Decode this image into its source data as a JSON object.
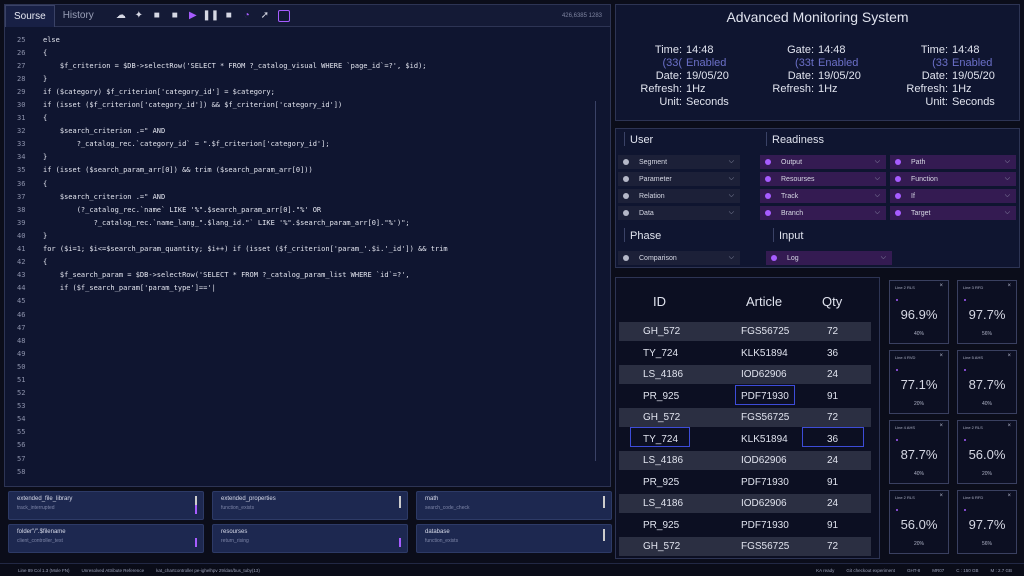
{
  "editor": {
    "tabs": [
      "Sourse",
      "History"
    ],
    "toolbar_icons": [
      "cloud-icon",
      "puzzle-icon",
      "stop-icon",
      "stop-icon",
      "play-icon",
      "pause-icon",
      "stop-icon",
      "clock-icon",
      "cursor-icon",
      "record-icon"
    ],
    "coords": "426,6385 1283",
    "lines": [
      {
        "n": "25",
        "code": "else"
      },
      {
        "n": "26",
        "code": "{"
      },
      {
        "n": "27",
        "code": "    $f_criterion = $DB->selectRow('SELECT * FROM ?_catalog_visual WHERE `page_id`=?', $id);"
      },
      {
        "n": "28",
        "code": "}"
      },
      {
        "n": "29",
        "code": "if ($category) $f_criterion['category_id'] = $category;"
      },
      {
        "n": "30",
        "code": "if (isset ($f_criterion['category_id']) && $f_criterion['category_id'])"
      },
      {
        "n": "31",
        "code": "{"
      },
      {
        "n": "32",
        "code": "    $search_criterion .=\" AND"
      },
      {
        "n": "33",
        "code": "        ?_catalog_rec.`category_id` = \".$f_criterion['category_id'];"
      },
      {
        "n": "34",
        "code": "}"
      },
      {
        "n": "35",
        "code": "if (isset ($search_param_arr[0]) && trim ($search_param_arr[0]))"
      },
      {
        "n": "36",
        "code": "{"
      },
      {
        "n": "37",
        "code": "    $search_criterion .=\" AND"
      },
      {
        "n": "38",
        "code": "        (?_catalog_rec.`name` LIKE '%\".$search_param_arr[0].\"%' OR"
      },
      {
        "n": "39",
        "code": "            ?_catalog_rec.`name_lang_\".$lang_id.\"` LIKE '%\".$search_param_arr[0].\"%')\";"
      },
      {
        "n": "40",
        "code": "}"
      },
      {
        "n": "41",
        "code": "for ($i=1; $i<=$search_param_quantity; $i++) if (isset ($f_criterion['param_'.$i.'_id']) && trim"
      },
      {
        "n": "42",
        "code": "{"
      },
      {
        "n": "43",
        "code": "    $f_search_param = $DB->selectRow('SELECT * FROM ?_catalog_param_list WHERE `id`=?',"
      },
      {
        "n": "44",
        "code": "    if ($f_search_param['param_type']=='|"
      },
      {
        "n": "45",
        "code": ""
      },
      {
        "n": "46",
        "code": ""
      },
      {
        "n": "47",
        "code": ""
      },
      {
        "n": "48",
        "code": ""
      },
      {
        "n": "49",
        "code": ""
      },
      {
        "n": "50",
        "code": ""
      },
      {
        "n": "51",
        "code": ""
      },
      {
        "n": "52",
        "code": ""
      },
      {
        "n": "53",
        "code": ""
      },
      {
        "n": "54",
        "code": ""
      },
      {
        "n": "55",
        "code": ""
      },
      {
        "n": "56",
        "code": ""
      },
      {
        "n": "57",
        "code": ""
      },
      {
        "n": "58",
        "code": ""
      }
    ]
  },
  "cards": [
    {
      "title": "extended_file_library",
      "sub": "track_interrupted"
    },
    {
      "title": "extended_properties",
      "sub": "function_exists"
    },
    {
      "title": "math",
      "sub": "search_code_check"
    },
    {
      "title": "folder\"/\".$filename",
      "sub": "client_controller_test"
    },
    {
      "title": "resourses",
      "sub": "return_rising"
    },
    {
      "title": "database",
      "sub": "function_exists"
    }
  ],
  "statusbar": {
    "items": [
      "Line 89 Col 1.3 (Mole FN)",
      "Unresolved Attribute Reference",
      "kat_chartcontroller pe-ighelhpv 29/das/bus_tuby(13)",
      "KA ready",
      "Git checkout experiment",
      "GHT-8",
      "MR07",
      "C : 150 GB",
      "M : 2.7 GB"
    ]
  },
  "monitor": {
    "title": "Advanced Monitoring System",
    "blocks": [
      {
        "rows": [
          {
            "k": "Time:",
            "v": "14:48"
          },
          {
            "k": "(33(",
            "v": "Enabled",
            "dim": true
          },
          {
            "k": "Date:",
            "v": "19/05/20"
          },
          {
            "k": "Refresh:",
            "v": "1Hz"
          },
          {
            "k": "Unit:",
            "v": "Seconds"
          }
        ]
      },
      {
        "rows": [
          {
            "k": "Gate:",
            "v": "14:48"
          },
          {
            "k": "(33t",
            "v": "Enabled",
            "dim": true
          },
          {
            "k": "Date:",
            "v": "19/05/20"
          },
          {
            "k": "Refresh:",
            "v": "1Hz"
          }
        ]
      },
      {
        "rows": [
          {
            "k": "Time:",
            "v": "14:48"
          },
          {
            "k": "(33",
            "v": "Enabled",
            "dim": true
          },
          {
            "k": "Date:",
            "v": "19/05/20"
          },
          {
            "k": "Refresh:",
            "v": "1Hz"
          },
          {
            "k": "Unit:",
            "v": "Seconds"
          }
        ]
      }
    ]
  },
  "filters": {
    "sections": {
      "user": "User",
      "readiness": "Readiness",
      "phase": "Phase",
      "input": "Input"
    },
    "user_items": [
      "Segment",
      "Parameter",
      "Relation",
      "Data"
    ],
    "readiness_a": [
      "Output",
      "Resourses",
      "Track",
      "Branch"
    ],
    "readiness_b": [
      "Path",
      "Function",
      "If",
      "Target"
    ],
    "phase_items": [
      "Comparison"
    ],
    "input_items": [
      "Log"
    ]
  },
  "table": {
    "headers": [
      "ID",
      "Article",
      "Qty"
    ],
    "rows": [
      [
        "GH_572",
        "FGS56725",
        "72"
      ],
      [
        "TY_724",
        "KLK51894",
        "36"
      ],
      [
        "LS_4186",
        "IOD62906",
        "24"
      ],
      [
        "PR_925",
        "PDF71930",
        "91"
      ],
      [
        "GH_572",
        "FGS56725",
        "72"
      ],
      [
        "TY_724",
        "KLK51894",
        "36"
      ],
      [
        "LS_4186",
        "IOD62906",
        "24"
      ],
      [
        "PR_925",
        "PDF71930",
        "91"
      ],
      [
        "LS_4186",
        "IOD62906",
        "24"
      ],
      [
        "PR_925",
        "PDF71930",
        "91"
      ],
      [
        "GH_572",
        "FGS56725",
        "72"
      ]
    ]
  },
  "gauges": [
    {
      "title": "Line 2 RLS",
      "value": "96.9%",
      "pct": "40%"
    },
    {
      "title": "Line 3 RFD",
      "value": "97.7%",
      "pct": "56%"
    },
    {
      "title": "Line 4 RVD",
      "value": "77.1%",
      "pct": "20%"
    },
    {
      "title": "Line 5 AHS",
      "value": "87.7%",
      "pct": "40%"
    },
    {
      "title": "Line 4 AHS",
      "value": "87.7%",
      "pct": "40%"
    },
    {
      "title": "Line 2 RLS",
      "value": "56.0%",
      "pct": "20%"
    },
    {
      "title": "Line 2 RLS",
      "value": "56.0%",
      "pct": "20%"
    },
    {
      "title": "Line 6 RFD",
      "value": "97.7%",
      "pct": "56%"
    }
  ]
}
